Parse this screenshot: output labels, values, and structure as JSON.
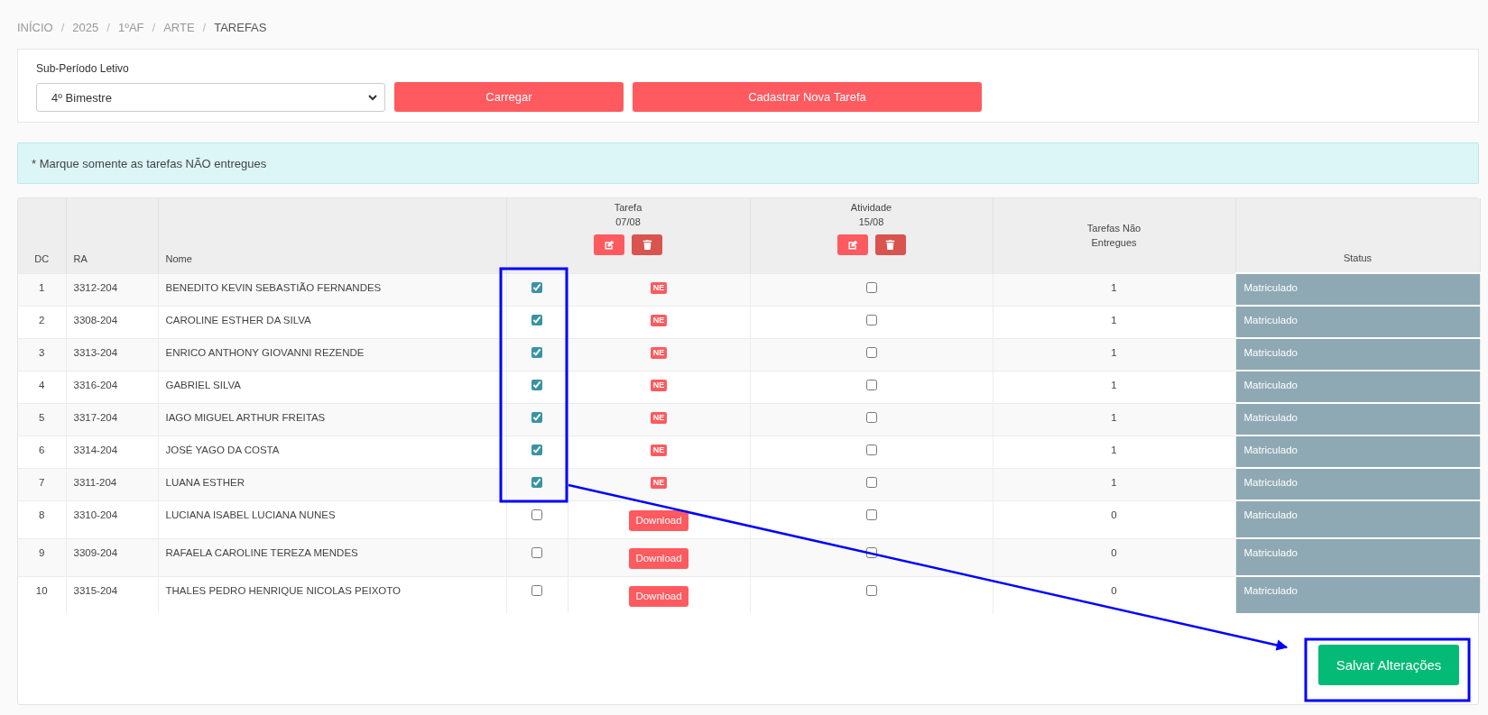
{
  "breadcrumb": {
    "separator": "/",
    "items": [
      {
        "label": "INÍCIO",
        "current": false
      },
      {
        "label": "2025",
        "current": false
      },
      {
        "label": "1ºAF",
        "current": false
      },
      {
        "label": "ARTE",
        "current": false
      },
      {
        "label": "TAREFAS",
        "current": true
      }
    ]
  },
  "filter": {
    "label": "Sub-Período Letivo",
    "value": "4º Bimestre",
    "buttons": [
      "Carregar",
      "Cadastrar Nova Tarefa"
    ]
  },
  "alert": "* Marque somente as tarefas NÃO entregues",
  "table": {
    "columns": [
      "DC",
      "RA",
      "Nome",
      "Tarefas Não Entregues",
      "Status"
    ],
    "tasks": [
      {
        "title": "Tarefa",
        "date": "07/08"
      },
      {
        "title": "Atividade",
        "date": "15/08"
      }
    ],
    "rows": [
      {
        "dc": "1",
        "ra": "3312-204",
        "name": "BENEDITO KEVIN SEBASTIÃO FERNANDES",
        "tarefa": {
          "checked": true,
          "kind": "badge",
          "label": "NE"
        },
        "atividade": {
          "checked": false
        },
        "count": "1",
        "status": "Matriculado"
      },
      {
        "dc": "2",
        "ra": "3308-204",
        "name": "CAROLINE ESTHER DA SILVA",
        "tarefa": {
          "checked": true,
          "kind": "badge",
          "label": "NE"
        },
        "atividade": {
          "checked": false
        },
        "count": "1",
        "status": "Matriculado"
      },
      {
        "dc": "3",
        "ra": "3313-204",
        "name": "ENRICO ANTHONY GIOVANNI REZENDE",
        "tarefa": {
          "checked": true,
          "kind": "badge",
          "label": "NE"
        },
        "atividade": {
          "checked": false
        },
        "count": "1",
        "status": "Matriculado"
      },
      {
        "dc": "4",
        "ra": "3316-204",
        "name": "GABRIEL SILVA",
        "tarefa": {
          "checked": true,
          "kind": "badge",
          "label": "NE"
        },
        "atividade": {
          "checked": false
        },
        "count": "1",
        "status": "Matriculado"
      },
      {
        "dc": "5",
        "ra": "3317-204",
        "name": "IAGO MIGUEL ARTHUR FREITAS",
        "tarefa": {
          "checked": true,
          "kind": "badge",
          "label": "NE"
        },
        "atividade": {
          "checked": false
        },
        "count": "1",
        "status": "Matriculado"
      },
      {
        "dc": "6",
        "ra": "3314-204",
        "name": "JOSÉ YAGO DA COSTA",
        "tarefa": {
          "checked": true,
          "kind": "badge",
          "label": "NE"
        },
        "atividade": {
          "checked": false
        },
        "count": "1",
        "status": "Matriculado"
      },
      {
        "dc": "7",
        "ra": "3311-204",
        "name": "LUANA ESTHER",
        "tarefa": {
          "checked": true,
          "kind": "badge",
          "label": "NE"
        },
        "atividade": {
          "checked": false
        },
        "count": "1",
        "status": "Matriculado"
      },
      {
        "dc": "8",
        "ra": "3310-204",
        "name": "LUCIANA ISABEL LUCIANA NUNES",
        "tarefa": {
          "checked": false,
          "kind": "button",
          "label": "Download"
        },
        "atividade": {
          "checked": false
        },
        "count": "0",
        "status": "Matriculado"
      },
      {
        "dc": "9",
        "ra": "3309-204",
        "name": "RAFAELA CAROLINE TEREZA MENDES",
        "tarefa": {
          "checked": false,
          "kind": "button",
          "label": "Download"
        },
        "atividade": {
          "checked": false
        },
        "count": "0",
        "status": "Matriculado"
      },
      {
        "dc": "10",
        "ra": "3315-204",
        "name": "THALES PEDRO HENRIQUE NICOLAS PEIXOTO",
        "tarefa": {
          "checked": false,
          "kind": "button",
          "label": "Download"
        },
        "atividade": {
          "checked": false
        },
        "count": "0",
        "status": "Matriculado"
      }
    ]
  },
  "save_button": "Salvar Alterações",
  "annotation": {
    "kind": "arrow-callout"
  }
}
